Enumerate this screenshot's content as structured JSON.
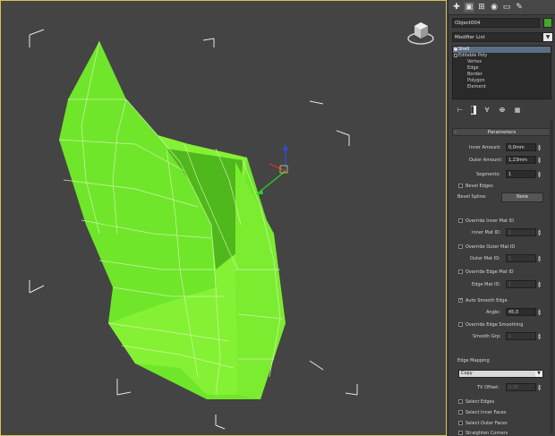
{
  "command_tabs": [
    "create-icon",
    "modify-icon",
    "hierarchy-icon",
    "motion-icon",
    "display-icon",
    "utilities-icon"
  ],
  "command_tab_glyphs": [
    "✚",
    "▣",
    "⊞",
    "◉",
    "▭",
    "✎"
  ],
  "object_name": "Object004",
  "object_color": "#46a82a",
  "modifier_list": {
    "label": "Modifier List",
    "arrow": "▼"
  },
  "stack": {
    "items": [
      {
        "label": "Shell",
        "selected": true
      },
      {
        "label": "Editable Poly",
        "selected": false
      },
      {
        "label": "Vertex",
        "sub": true
      },
      {
        "label": "Edge",
        "sub": true
      },
      {
        "label": "Border",
        "sub": true
      },
      {
        "label": "Polygon",
        "sub": true
      },
      {
        "label": "Element",
        "sub": true
      }
    ]
  },
  "stack_tools": [
    "pin-stack-icon",
    "show-end-result-icon",
    "make-unique-icon",
    "remove-modifier-icon",
    "configure-modifier-sets-icon"
  ],
  "stack_tool_glyphs": [
    "⊢",
    "▌",
    "∀",
    "ⴲ",
    "▦"
  ],
  "parameters": {
    "title": "Parameters",
    "collapse": "-",
    "inner_amount_label": "Inner Amount:",
    "inner_amount": "0,0mm",
    "outer_amount_label": "Outer Amount:",
    "outer_amount": "1,23mm",
    "segments_label": "Segments:",
    "segments": "1",
    "bevel_edges": "Bevel Edges",
    "bevel_spline_label": "Bevel Spline:",
    "bevel_spline_value": "None",
    "override_inner_mat": "Override Inner Mat ID",
    "inner_mat_label": "Inner Mat ID:",
    "inner_mat": "1",
    "override_outer_mat": "Override Outer Mat ID",
    "outer_mat_label": "Outer Mat ID:",
    "outer_mat": "1",
    "override_edge_mat": "Override Edge Mat ID",
    "edge_mat_label": "Edge Mat ID:",
    "edge_mat": "1",
    "auto_smooth_edge": "Auto Smooth Edge",
    "angle_label": "Angle:",
    "angle": "45,0",
    "override_edge_smoothing": "Override Edge Smoothing",
    "smooth_grp_label": "Smooth Grp:",
    "smooth_grp": "1",
    "edge_mapping_label": "Edge Mapping",
    "edge_mapping": "Copy",
    "tv_offset_label": "TV Offset:",
    "tv_offset": "0,05",
    "select_edges": "Select Edges",
    "select_inner_faces": "Select Inner Faces",
    "select_outer_faces": "Select Outer Faces",
    "straighten_corners": "Straighten Corners"
  }
}
